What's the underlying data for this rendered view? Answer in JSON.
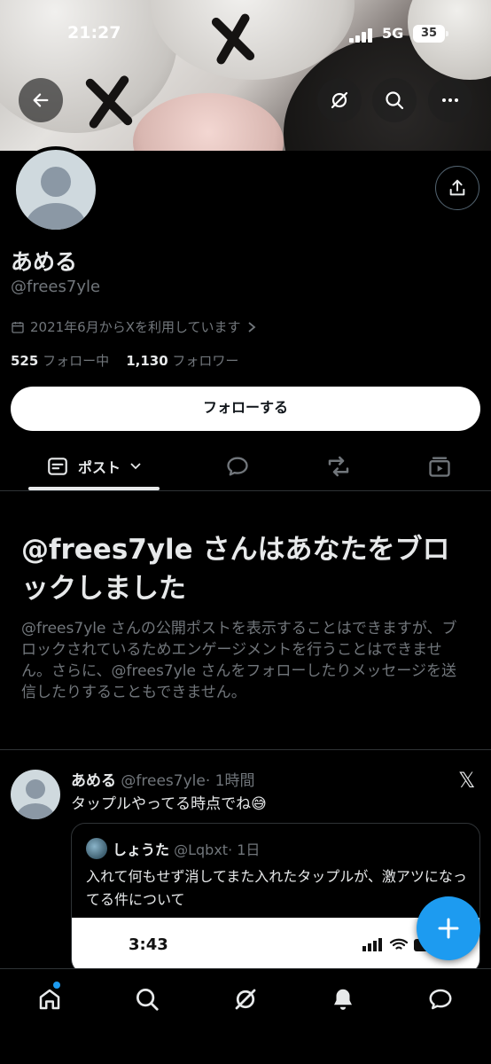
{
  "status_bar": {
    "time": "21:27",
    "network": "5G",
    "battery": "35"
  },
  "profile": {
    "name": "あめる",
    "handle": "@frees7yle",
    "joined": "2021年6月からXを利用しています",
    "following_count": "525",
    "following_label": "フォロー中",
    "followers_count": "1,130",
    "followers_label": "フォロワー",
    "follow_button": "フォローする"
  },
  "tabs": {
    "posts_label": "ポスト"
  },
  "blocked": {
    "title": "@frees7yle さんはあなたをブロックしました",
    "description": "@frees7yle さんの公開ポストを表示することはできますが、ブロックされているためエンゲージメントを行うことはできません。さらに、@frees7yle さんをフォローしたりメッセージを送信したりすることもできません。"
  },
  "post": {
    "name": "あめる",
    "handle": "@frees7yle",
    "time": "· 1時間",
    "text": "タップルやってる時点でね",
    "emoji": "😅",
    "quote": {
      "name": "しょうた",
      "handle": "@Lqbxt",
      "time": "· 1日",
      "text": "入れて何もせず消してまた入れたタップルが、激アツになってる件について",
      "image_time": "3:43"
    }
  },
  "colors": {
    "accent": "#1d9bf0",
    "background": "#000000",
    "text": "#e7e9ea",
    "muted": "#71767b"
  }
}
